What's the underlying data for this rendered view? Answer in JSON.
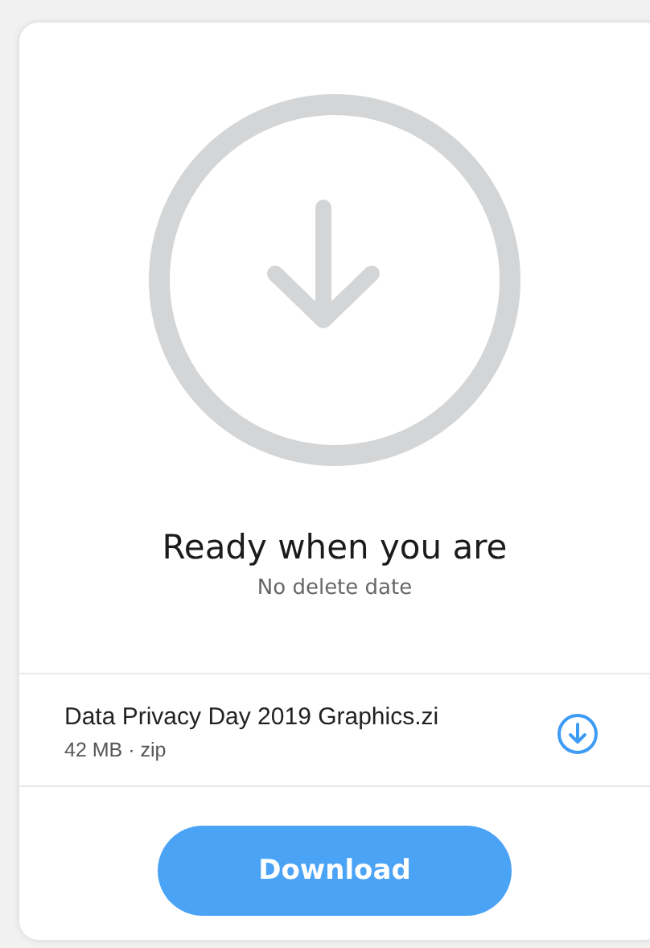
{
  "status": {
    "title": "Ready when you are",
    "subtitle": "No delete date"
  },
  "file": {
    "name": "Data Privacy Day 2019 Graphics.zi",
    "meta": "42 MB · zip"
  },
  "buttons": [
    {
      "label": "Download",
      "kind": "primary"
    }
  ]
}
